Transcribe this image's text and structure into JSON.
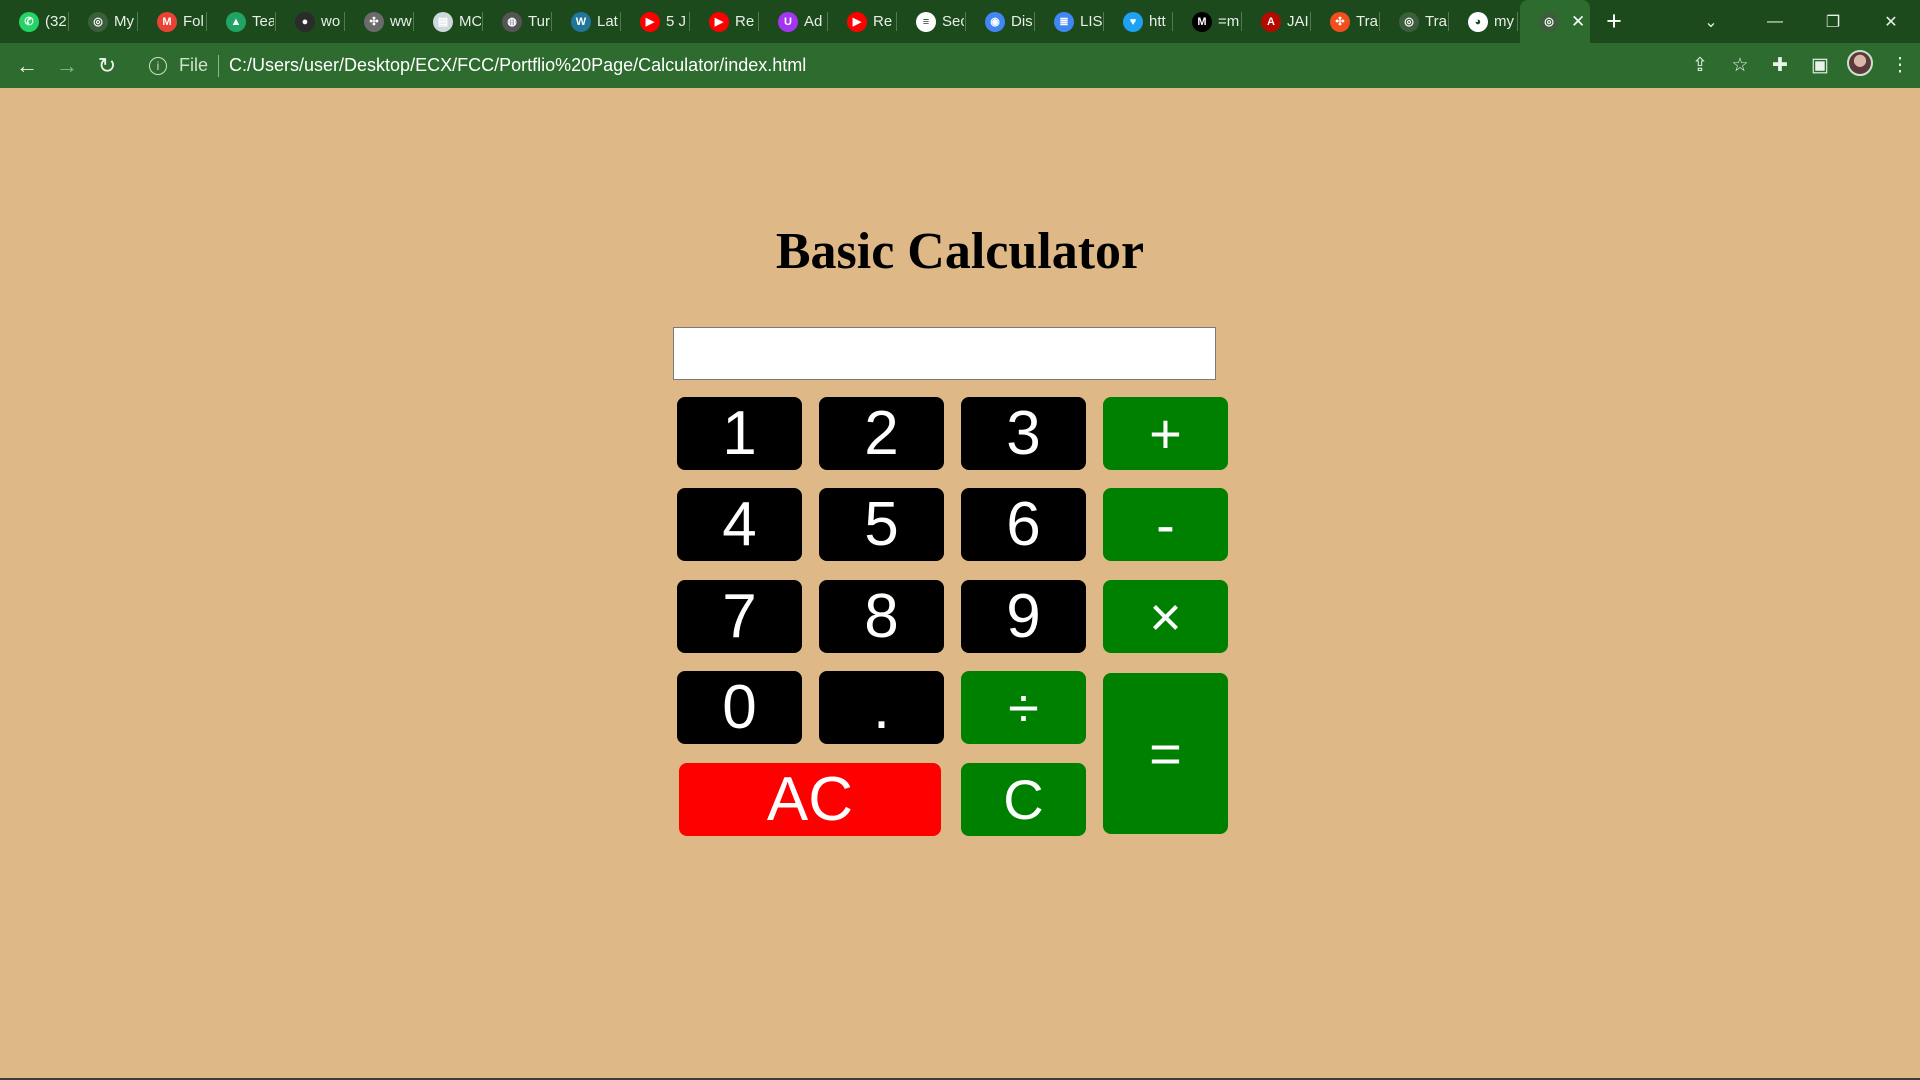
{
  "browser": {
    "tabs": [
      {
        "icon": "whatsapp-icon",
        "color": "#25d366",
        "short": "(32"
      },
      {
        "icon": "chatgpt-icon",
        "color": "#3c5e3c",
        "short": "My"
      },
      {
        "icon": "gmail-icon",
        "color": "#ea4335",
        "short": "Fol"
      },
      {
        "icon": "google-drive-icon",
        "color": "#1fa463",
        "short": "Tea"
      },
      {
        "icon": "profile-icon",
        "color": "#2b2b2b",
        "short": "wo"
      },
      {
        "icon": "figma-icon",
        "color": "#6b6b6b",
        "short": "ww"
      },
      {
        "icon": "doc-icon",
        "color": "#cfd8dc",
        "short": "MC"
      },
      {
        "icon": "globe-icon",
        "color": "#555555",
        "short": "Tur"
      },
      {
        "icon": "wordpress-icon",
        "color": "#21759b",
        "short": "Lat"
      },
      {
        "icon": "youtube-icon",
        "color": "#ff0000",
        "short": "5 J"
      },
      {
        "icon": "youtube-icon",
        "color": "#ff0000",
        "short": "Re"
      },
      {
        "icon": "udemy-icon",
        "color": "#a435f0",
        "short": "Ad"
      },
      {
        "icon": "youtube-icon",
        "color": "#ff0000",
        "short": "Re"
      },
      {
        "icon": "bars-icon",
        "color": "#ffffff",
        "short": "Sec"
      },
      {
        "icon": "chrome-icon",
        "color": "#4285f4",
        "short": "Dis"
      },
      {
        "icon": "docs-icon",
        "color": "#4285f4",
        "short": "LIS"
      },
      {
        "icon": "twitter-icon",
        "color": "#1da1f2",
        "short": "htt"
      },
      {
        "icon": "medium-icon",
        "color": "#000000",
        "short": "=m"
      },
      {
        "icon": "acrobat-icon",
        "color": "#b30b00",
        "short": "JAI"
      },
      {
        "icon": "figma-icon",
        "color": "#f24e1e",
        "short": "Tra"
      },
      {
        "icon": "chatgpt-icon",
        "color": "#3c5e3c",
        "short": "Tra"
      },
      {
        "icon": "github-icon",
        "color": "#ffffff",
        "short": "my"
      }
    ],
    "active_tab_icon": "chatgpt-icon",
    "address": {
      "scheme": "File",
      "url": "C:/Users/user/Desktop/ECX/FCC/Portflio%20Page/Calculator/index.html"
    }
  },
  "page": {
    "title": "Basic Calculator",
    "display_value": ""
  },
  "keys": {
    "k1": "1",
    "k2": "2",
    "k3": "3",
    "plus": "+",
    "k4": "4",
    "k5": "5",
    "k6": "6",
    "minus": "-",
    "k7": "7",
    "k8": "8",
    "k9": "9",
    "times": "×",
    "k0": "0",
    "dot": ".",
    "divide": "÷",
    "equals": "=",
    "ac": "AC",
    "clear": "C"
  },
  "colors": {
    "page_background": "#deb887",
    "number_key": "#000000",
    "operator_key": "#008000",
    "all_clear_key": "#ff0000",
    "browser_chrome": "#2e6b2e"
  }
}
